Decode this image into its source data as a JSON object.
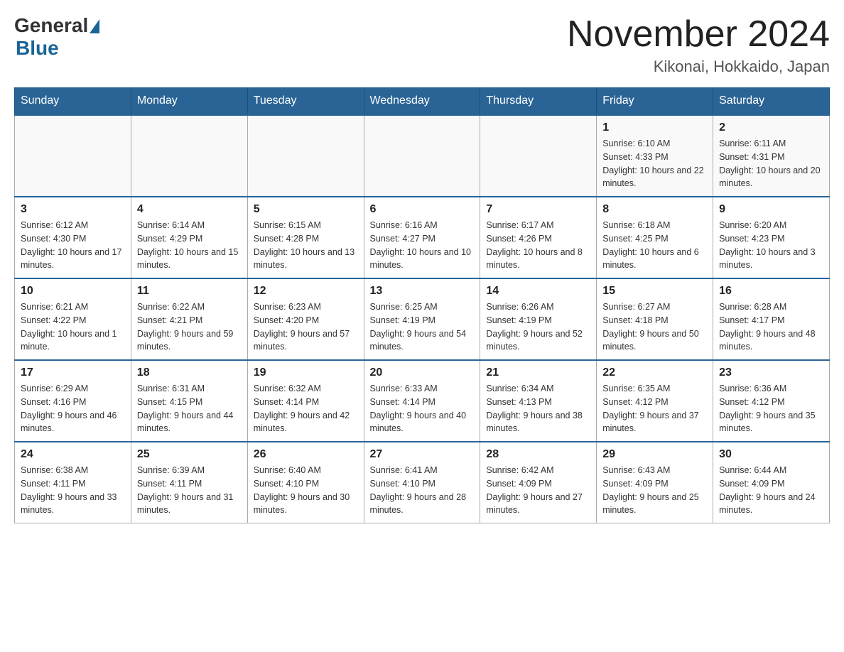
{
  "logo": {
    "general": "General",
    "blue": "Blue"
  },
  "header": {
    "month_year": "November 2024",
    "location": "Kikonai, Hokkaido, Japan"
  },
  "days_of_week": [
    "Sunday",
    "Monday",
    "Tuesday",
    "Wednesday",
    "Thursday",
    "Friday",
    "Saturday"
  ],
  "weeks": [
    [
      {
        "day": "",
        "info": ""
      },
      {
        "day": "",
        "info": ""
      },
      {
        "day": "",
        "info": ""
      },
      {
        "day": "",
        "info": ""
      },
      {
        "day": "",
        "info": ""
      },
      {
        "day": "1",
        "info": "Sunrise: 6:10 AM\nSunset: 4:33 PM\nDaylight: 10 hours and 22 minutes."
      },
      {
        "day": "2",
        "info": "Sunrise: 6:11 AM\nSunset: 4:31 PM\nDaylight: 10 hours and 20 minutes."
      }
    ],
    [
      {
        "day": "3",
        "info": "Sunrise: 6:12 AM\nSunset: 4:30 PM\nDaylight: 10 hours and 17 minutes."
      },
      {
        "day": "4",
        "info": "Sunrise: 6:14 AM\nSunset: 4:29 PM\nDaylight: 10 hours and 15 minutes."
      },
      {
        "day": "5",
        "info": "Sunrise: 6:15 AM\nSunset: 4:28 PM\nDaylight: 10 hours and 13 minutes."
      },
      {
        "day": "6",
        "info": "Sunrise: 6:16 AM\nSunset: 4:27 PM\nDaylight: 10 hours and 10 minutes."
      },
      {
        "day": "7",
        "info": "Sunrise: 6:17 AM\nSunset: 4:26 PM\nDaylight: 10 hours and 8 minutes."
      },
      {
        "day": "8",
        "info": "Sunrise: 6:18 AM\nSunset: 4:25 PM\nDaylight: 10 hours and 6 minutes."
      },
      {
        "day": "9",
        "info": "Sunrise: 6:20 AM\nSunset: 4:23 PM\nDaylight: 10 hours and 3 minutes."
      }
    ],
    [
      {
        "day": "10",
        "info": "Sunrise: 6:21 AM\nSunset: 4:22 PM\nDaylight: 10 hours and 1 minute."
      },
      {
        "day": "11",
        "info": "Sunrise: 6:22 AM\nSunset: 4:21 PM\nDaylight: 9 hours and 59 minutes."
      },
      {
        "day": "12",
        "info": "Sunrise: 6:23 AM\nSunset: 4:20 PM\nDaylight: 9 hours and 57 minutes."
      },
      {
        "day": "13",
        "info": "Sunrise: 6:25 AM\nSunset: 4:19 PM\nDaylight: 9 hours and 54 minutes."
      },
      {
        "day": "14",
        "info": "Sunrise: 6:26 AM\nSunset: 4:19 PM\nDaylight: 9 hours and 52 minutes."
      },
      {
        "day": "15",
        "info": "Sunrise: 6:27 AM\nSunset: 4:18 PM\nDaylight: 9 hours and 50 minutes."
      },
      {
        "day": "16",
        "info": "Sunrise: 6:28 AM\nSunset: 4:17 PM\nDaylight: 9 hours and 48 minutes."
      }
    ],
    [
      {
        "day": "17",
        "info": "Sunrise: 6:29 AM\nSunset: 4:16 PM\nDaylight: 9 hours and 46 minutes."
      },
      {
        "day": "18",
        "info": "Sunrise: 6:31 AM\nSunset: 4:15 PM\nDaylight: 9 hours and 44 minutes."
      },
      {
        "day": "19",
        "info": "Sunrise: 6:32 AM\nSunset: 4:14 PM\nDaylight: 9 hours and 42 minutes."
      },
      {
        "day": "20",
        "info": "Sunrise: 6:33 AM\nSunset: 4:14 PM\nDaylight: 9 hours and 40 minutes."
      },
      {
        "day": "21",
        "info": "Sunrise: 6:34 AM\nSunset: 4:13 PM\nDaylight: 9 hours and 38 minutes."
      },
      {
        "day": "22",
        "info": "Sunrise: 6:35 AM\nSunset: 4:12 PM\nDaylight: 9 hours and 37 minutes."
      },
      {
        "day": "23",
        "info": "Sunrise: 6:36 AM\nSunset: 4:12 PM\nDaylight: 9 hours and 35 minutes."
      }
    ],
    [
      {
        "day": "24",
        "info": "Sunrise: 6:38 AM\nSunset: 4:11 PM\nDaylight: 9 hours and 33 minutes."
      },
      {
        "day": "25",
        "info": "Sunrise: 6:39 AM\nSunset: 4:11 PM\nDaylight: 9 hours and 31 minutes."
      },
      {
        "day": "26",
        "info": "Sunrise: 6:40 AM\nSunset: 4:10 PM\nDaylight: 9 hours and 30 minutes."
      },
      {
        "day": "27",
        "info": "Sunrise: 6:41 AM\nSunset: 4:10 PM\nDaylight: 9 hours and 28 minutes."
      },
      {
        "day": "28",
        "info": "Sunrise: 6:42 AM\nSunset: 4:09 PM\nDaylight: 9 hours and 27 minutes."
      },
      {
        "day": "29",
        "info": "Sunrise: 6:43 AM\nSunset: 4:09 PM\nDaylight: 9 hours and 25 minutes."
      },
      {
        "day": "30",
        "info": "Sunrise: 6:44 AM\nSunset: 4:09 PM\nDaylight: 9 hours and 24 minutes."
      }
    ]
  ]
}
